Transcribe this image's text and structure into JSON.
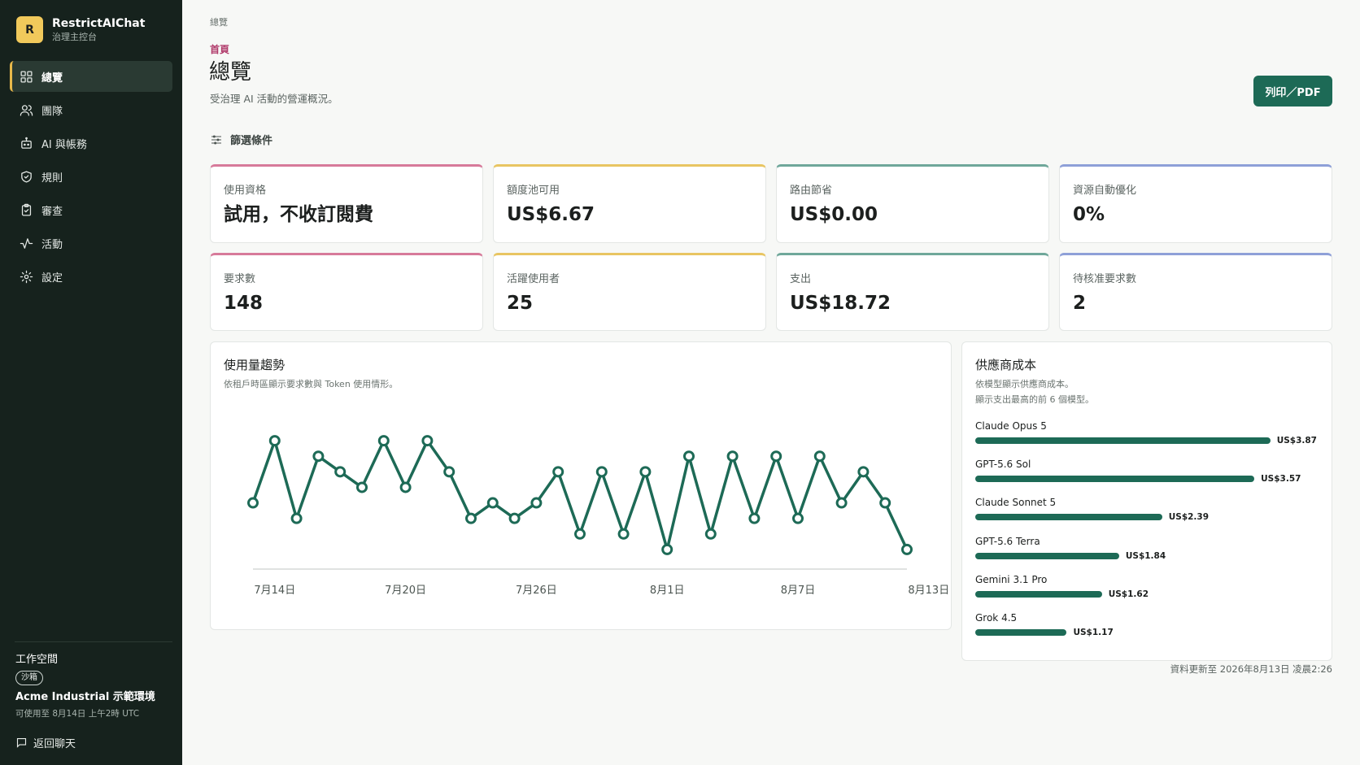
{
  "brand": {
    "logo": "R",
    "name": "RestrictAIChat",
    "subtitle": "治理主控台"
  },
  "nav": [
    {
      "label": "總覽",
      "icon": "grid-icon",
      "active": true
    },
    {
      "label": "團隊",
      "icon": "users-icon"
    },
    {
      "label": "AI 與帳務",
      "icon": "bot-icon"
    },
    {
      "label": "規則",
      "icon": "shield-icon"
    },
    {
      "label": "審查",
      "icon": "clipboard-icon"
    },
    {
      "label": "活動",
      "icon": "activity-icon"
    },
    {
      "label": "設定",
      "icon": "gear-icon"
    }
  ],
  "workspace": {
    "label": "工作空間",
    "badge": "沙箱",
    "name": "Acme Industrial 示範環境",
    "meta": "可使用至 8月14日 上午2時 UTC",
    "back_label": "返回聊天"
  },
  "header": {
    "breadcrumb": "總覽",
    "eyebrow": "首頁",
    "title": "總覽",
    "subtitle": "受治理 AI 活動的營運概況。",
    "print_label": "列印／PDF"
  },
  "filters_label": "篩選條件",
  "colors": {
    "pink": "#d77a9a",
    "yellow": "#e8c562",
    "teal": "#6fa79a",
    "blue": "#8ea0d8",
    "accent": "#1d6a56"
  },
  "stats": [
    {
      "label": "使用資格",
      "value": "試用，不收訂閱費",
      "color": "pink"
    },
    {
      "label": "額度池可用",
      "value": "US$6.67",
      "color": "yellow"
    },
    {
      "label": "路由節省",
      "value": "US$0.00",
      "color": "teal"
    },
    {
      "label": "資源自動優化",
      "value": "0%",
      "color": "blue"
    },
    {
      "label": "要求數",
      "value": "148",
      "color": "pink"
    },
    {
      "label": "活躍使用者",
      "value": "25",
      "color": "yellow"
    },
    {
      "label": "支出",
      "value": "US$18.72",
      "color": "teal"
    },
    {
      "label": "待核准要求數",
      "value": "2",
      "color": "blue"
    }
  ],
  "usage_trend": {
    "title": "使用量趨勢",
    "subtitle": "依租戶時區顯示要求數與 Token 使用情形。"
  },
  "provider_cost": {
    "title": "供應商成本",
    "subtitle_1": "依模型顯示供應商成本。",
    "subtitle_2": "顯示支出最高的前 6 個模型。"
  },
  "chart_data": [
    {
      "type": "line",
      "title": "使用量趨勢",
      "x": [
        "7月13日",
        "7月14日",
        "7月15日",
        "7月16日",
        "7月17日",
        "7月18日",
        "7月19日",
        "7月20日",
        "7月21日",
        "7月22日",
        "7月23日",
        "7月24日",
        "7月25日",
        "7月26日",
        "7月27日",
        "7月28日",
        "7月29日",
        "7月30日",
        "7月31日",
        "8月1日",
        "8月2日",
        "8月3日",
        "8月4日",
        "8月5日",
        "8月6日",
        "8月7日",
        "8月8日",
        "8月9日",
        "8月10日",
        "8月11日",
        "8月12日",
        "8月13日",
        "8月14日"
      ],
      "tick_labels": [
        "7月14日",
        "7月20日",
        "7月26日",
        "8月1日",
        "8月7日",
        "8月13日"
      ],
      "values": [
        4,
        8,
        3,
        7,
        6,
        5,
        8,
        5,
        8,
        6,
        3,
        4,
        3,
        4,
        6,
        2,
        6,
        2,
        6,
        1,
        7,
        2,
        7,
        3,
        7,
        3,
        7,
        4,
        6,
        4,
        1
      ],
      "ylim": [
        0,
        9
      ],
      "grid": false,
      "color": "#1d6a56"
    },
    {
      "type": "bar",
      "title": "供應商成本",
      "orientation": "horizontal",
      "categories": [
        "Claude Opus 5",
        "GPT-5.6 Sol",
        "Claude Sonnet 5",
        "GPT-5.6 Terra",
        "Gemini 3.1 Pro",
        "Grok 4.5"
      ],
      "values": [
        3.87,
        3.57,
        2.39,
        1.84,
        1.62,
        1.17
      ],
      "value_labels": [
        "US$3.87",
        "US$3.57",
        "US$2.39",
        "US$1.84",
        "US$1.62",
        "US$1.17"
      ],
      "xlim": [
        0,
        3.87
      ],
      "color": "#1d6a56"
    }
  ],
  "footer_updated": "資料更新至 2026年8月13日 凌晨2:26"
}
